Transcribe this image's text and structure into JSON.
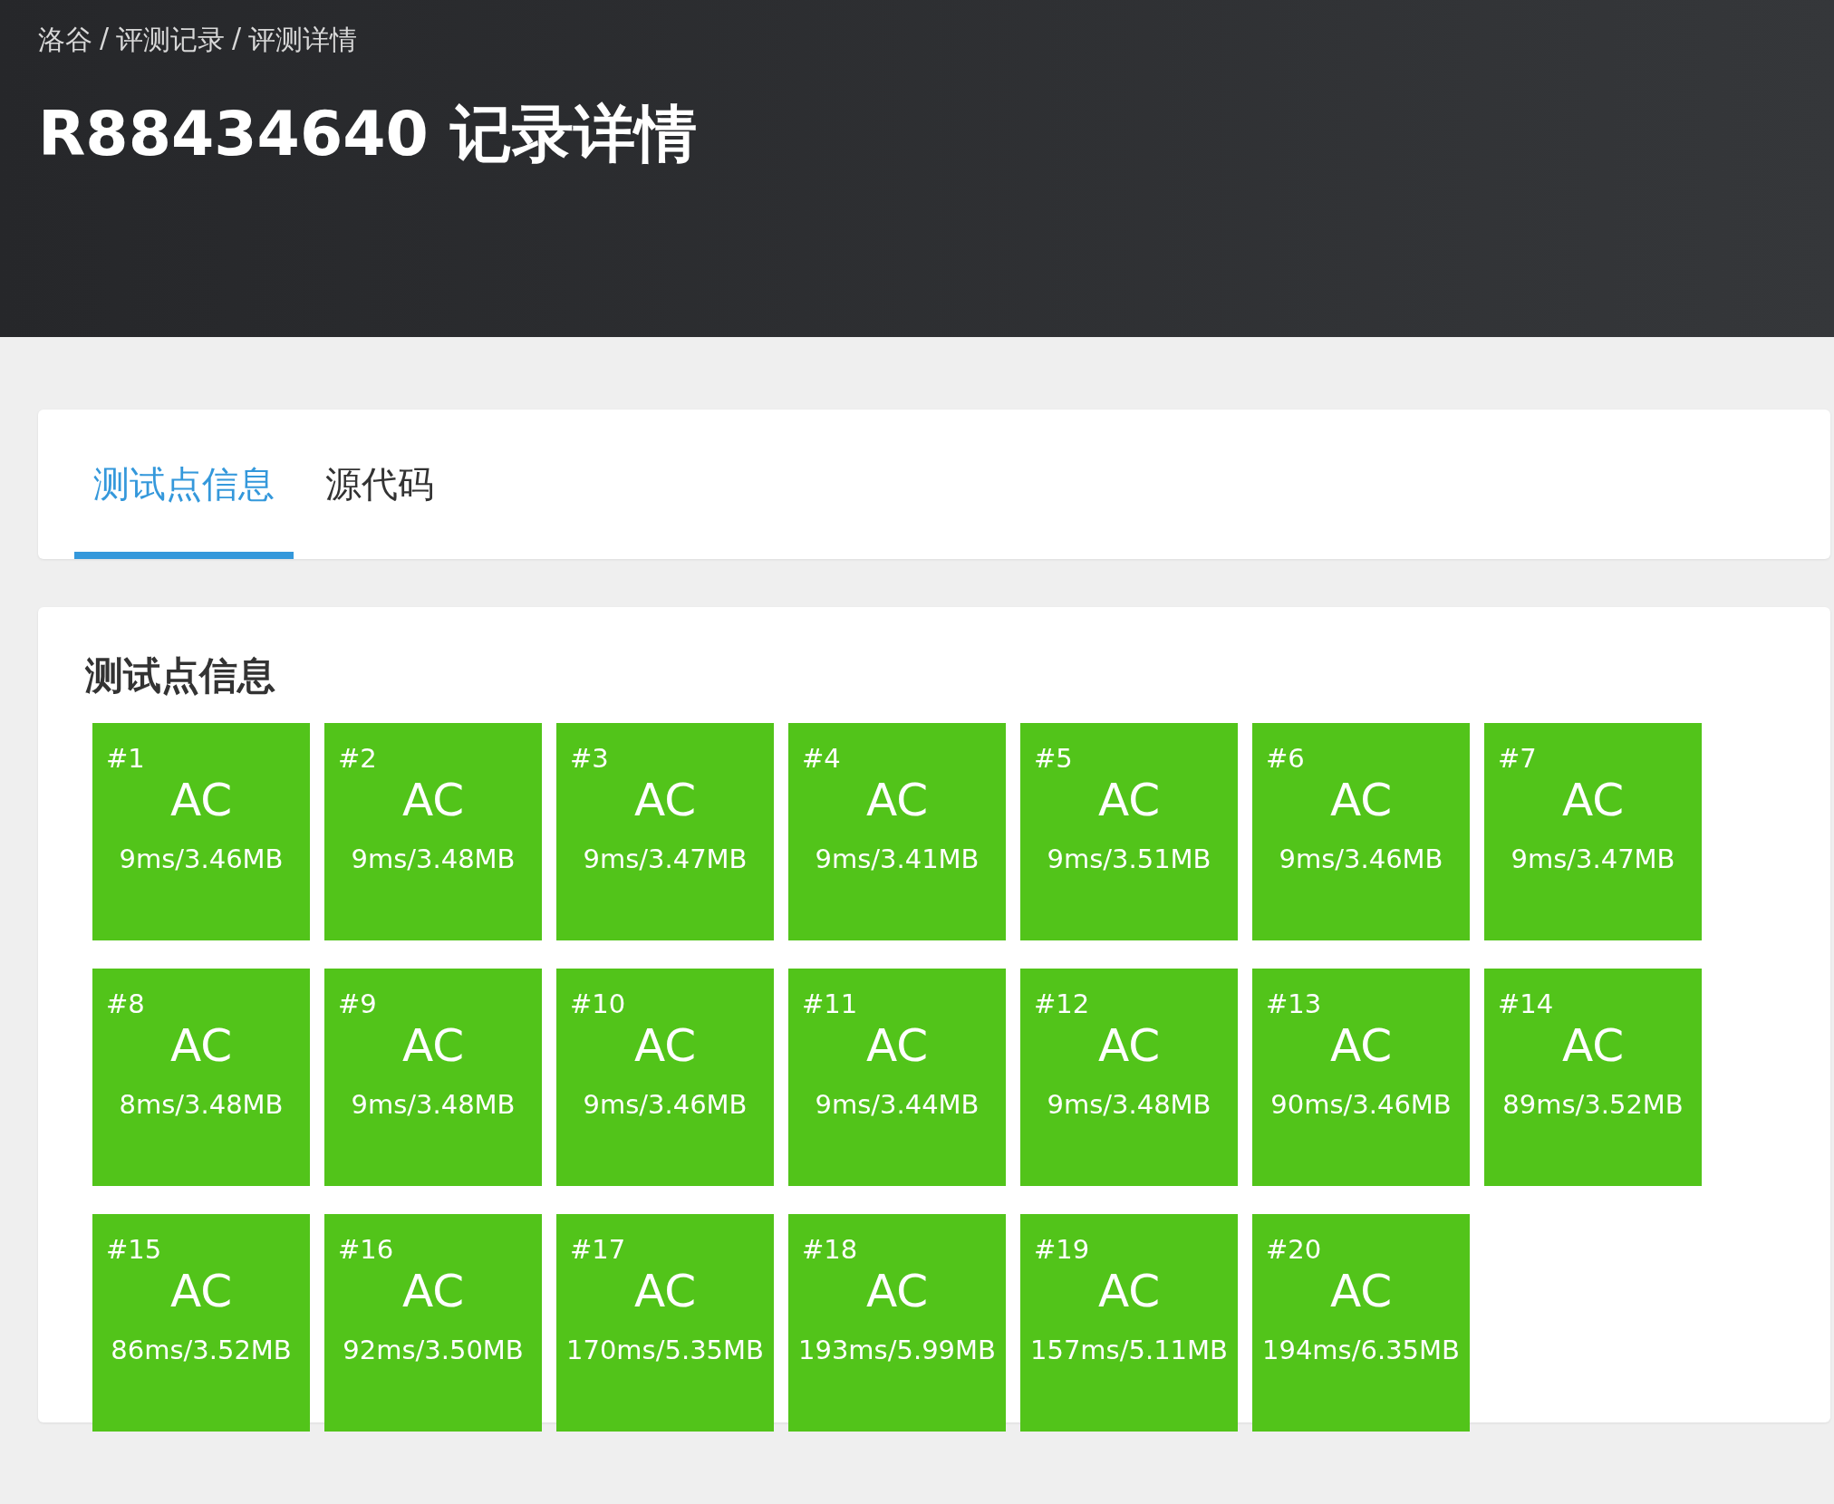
{
  "breadcrumb": [
    "洛谷",
    "评测记录",
    "评测详情"
  ],
  "breadcrumb_separator": "/",
  "title": "R88434640 记录详情",
  "tabs": [
    {
      "label": "测试点信息",
      "selected": true
    },
    {
      "label": "源代码",
      "selected": false
    }
  ],
  "section_title": "测试点信息",
  "cases": [
    {
      "label": "#1",
      "status": "AC",
      "detail": "9ms/3.46MB",
      "color": "#52c41a"
    },
    {
      "label": "#2",
      "status": "AC",
      "detail": "9ms/3.48MB",
      "color": "#52c41a"
    },
    {
      "label": "#3",
      "status": "AC",
      "detail": "9ms/3.47MB",
      "color": "#52c41a"
    },
    {
      "label": "#4",
      "status": "AC",
      "detail": "9ms/3.41MB",
      "color": "#52c41a"
    },
    {
      "label": "#5",
      "status": "AC",
      "detail": "9ms/3.51MB",
      "color": "#52c41a"
    },
    {
      "label": "#6",
      "status": "AC",
      "detail": "9ms/3.46MB",
      "color": "#52c41a"
    },
    {
      "label": "#7",
      "status": "AC",
      "detail": "9ms/3.47MB",
      "color": "#52c41a"
    },
    {
      "label": "#8",
      "status": "AC",
      "detail": "8ms/3.48MB",
      "color": "#52c41a"
    },
    {
      "label": "#9",
      "status": "AC",
      "detail": "9ms/3.48MB",
      "color": "#52c41a"
    },
    {
      "label": "#10",
      "status": "AC",
      "detail": "9ms/3.46MB",
      "color": "#52c41a"
    },
    {
      "label": "#11",
      "status": "AC",
      "detail": "9ms/3.44MB",
      "color": "#52c41a"
    },
    {
      "label": "#12",
      "status": "AC",
      "detail": "9ms/3.48MB",
      "color": "#52c41a"
    },
    {
      "label": "#13",
      "status": "AC",
      "detail": "90ms/3.46MB",
      "color": "#52c41a"
    },
    {
      "label": "#14",
      "status": "AC",
      "detail": "89ms/3.52MB",
      "color": "#52c41a"
    },
    {
      "label": "#15",
      "status": "AC",
      "detail": "86ms/3.52MB",
      "color": "#52c41a"
    },
    {
      "label": "#16",
      "status": "AC",
      "detail": "92ms/3.50MB",
      "color": "#52c41a"
    },
    {
      "label": "#17",
      "status": "AC",
      "detail": "170ms/5.35MB",
      "color": "#52c41a"
    },
    {
      "label": "#18",
      "status": "AC",
      "detail": "193ms/5.99MB",
      "color": "#52c41a"
    },
    {
      "label": "#19",
      "status": "AC",
      "detail": "157ms/5.11MB",
      "color": "#52c41a"
    },
    {
      "label": "#20",
      "status": "AC",
      "detail": "194ms/6.35MB",
      "color": "#52c41a"
    }
  ]
}
